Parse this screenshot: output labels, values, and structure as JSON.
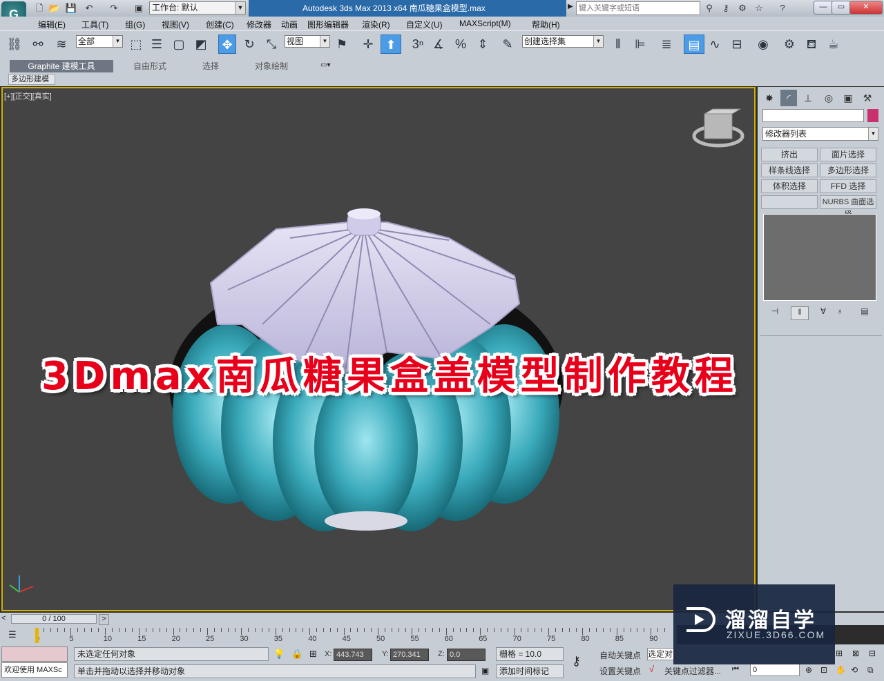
{
  "titlebar": {
    "workspace_label": "工作台: 默认",
    "app_title": "Autodesk 3ds Max  2013 x64       南瓜糖果盒模型.max",
    "search_placeholder": "键入关键字或短语"
  },
  "menus": [
    "编辑(E)",
    "工具(T)",
    "组(G)",
    "视图(V)",
    "创建(C)",
    "修改器",
    "动画",
    "图形编辑器",
    "渲染(R)",
    "自定义(U)",
    "MAXScript(M)",
    "帮助(H)"
  ],
  "toolbar": {
    "selection_filter": "全部",
    "ref_coord": "视图",
    "named_selection": "创建选择集"
  },
  "ribbon": {
    "tabs": [
      "Graphite 建模工具",
      "自由形式",
      "选择",
      "对象绘制"
    ],
    "active_tab": "Graphite 建模工具",
    "subpanel": "多边形建模"
  },
  "viewport": {
    "label": "[+][正交][真实]",
    "overlay_title": "3Dmax南瓜糖果盒盖模型制作教程"
  },
  "command_panel": {
    "modifier_list": "修改器列表",
    "modifier_buttons": [
      "挤出",
      "面片选择",
      "样条线选择",
      "多边形选择",
      "体积选择",
      "FFD 选择",
      "",
      "NURBS 曲面选择"
    ],
    "colors": {
      "object_color": "#c8306e"
    }
  },
  "timeline": {
    "slider_label": "0 / 100",
    "ticks": [
      "0",
      "5",
      "10",
      "15",
      "20",
      "25",
      "30",
      "35",
      "40",
      "45",
      "50",
      "55",
      "60",
      "65",
      "70",
      "75",
      "80",
      "85",
      "90"
    ]
  },
  "status": {
    "maxscript_welcome": "欢迎使用 MAXSc",
    "selection_status": "未选定任何对象",
    "prompt": "单击并拖动以选择并移动对象",
    "x_label": "X:",
    "x_value": "443.743",
    "y_label": "Y:",
    "y_value": "270.341",
    "z_label": "Z:",
    "z_value": "0.0",
    "grid": "栅格 = 10.0",
    "add_time_tag": "添加时间标记",
    "auto_key": "自动关键点",
    "set_key": "设置关键点",
    "selected_dropdown": "选定对",
    "key_filters": "关键点过滤器...",
    "frame_value": "0"
  },
  "watermark": {
    "name": "溜溜自学",
    "url": "ZIXUE.3D66.COM"
  }
}
